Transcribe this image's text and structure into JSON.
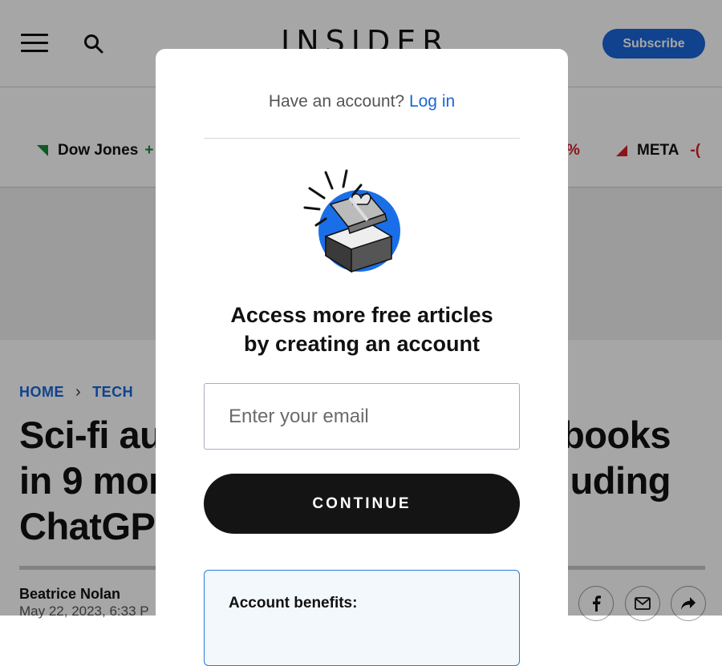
{
  "header": {
    "logo": "INSIDER",
    "subscribe_label": "Subscribe"
  },
  "ticker": {
    "items": [
      {
        "name": "Dow Jones",
        "change": "+",
        "direction": "down-triangle",
        "color": "#18893a"
      },
      {
        "name": "",
        "change": "%",
        "color": "#d3202b"
      },
      {
        "name": "META",
        "change": "-(",
        "direction": "up-triangle",
        "color": "#d3202b"
      }
    ]
  },
  "breadcrumb": {
    "home": "HOME",
    "separator": "›",
    "section": "TECH"
  },
  "article": {
    "headline_lines": [
      {
        "left": "Sci-fi au",
        "right": "books"
      },
      {
        "left": "in 9 mor",
        "right": "uding"
      },
      {
        "left": "ChatGP",
        "right": ""
      }
    ],
    "author": "Beatrice Nolan",
    "date": "May 22, 2023, 6:33 P"
  },
  "modal": {
    "have_account": "Have an account?",
    "login_label": "Log in",
    "title_line1": "Access more free articles",
    "title_line2": "by creating an account",
    "email_placeholder": "Enter your email",
    "continue_label": "CONTINUE",
    "benefits_title": "Account benefits:"
  },
  "colors": {
    "accent": "#1a66d9",
    "button_dark": "#141414",
    "positive": "#18893a",
    "negative": "#d3202b"
  },
  "icons": {
    "menu": "hamburger-icon",
    "search": "search-icon",
    "gift": "gift-box-icon",
    "facebook": "facebook-icon",
    "email": "mail-icon",
    "share": "share-icon"
  }
}
